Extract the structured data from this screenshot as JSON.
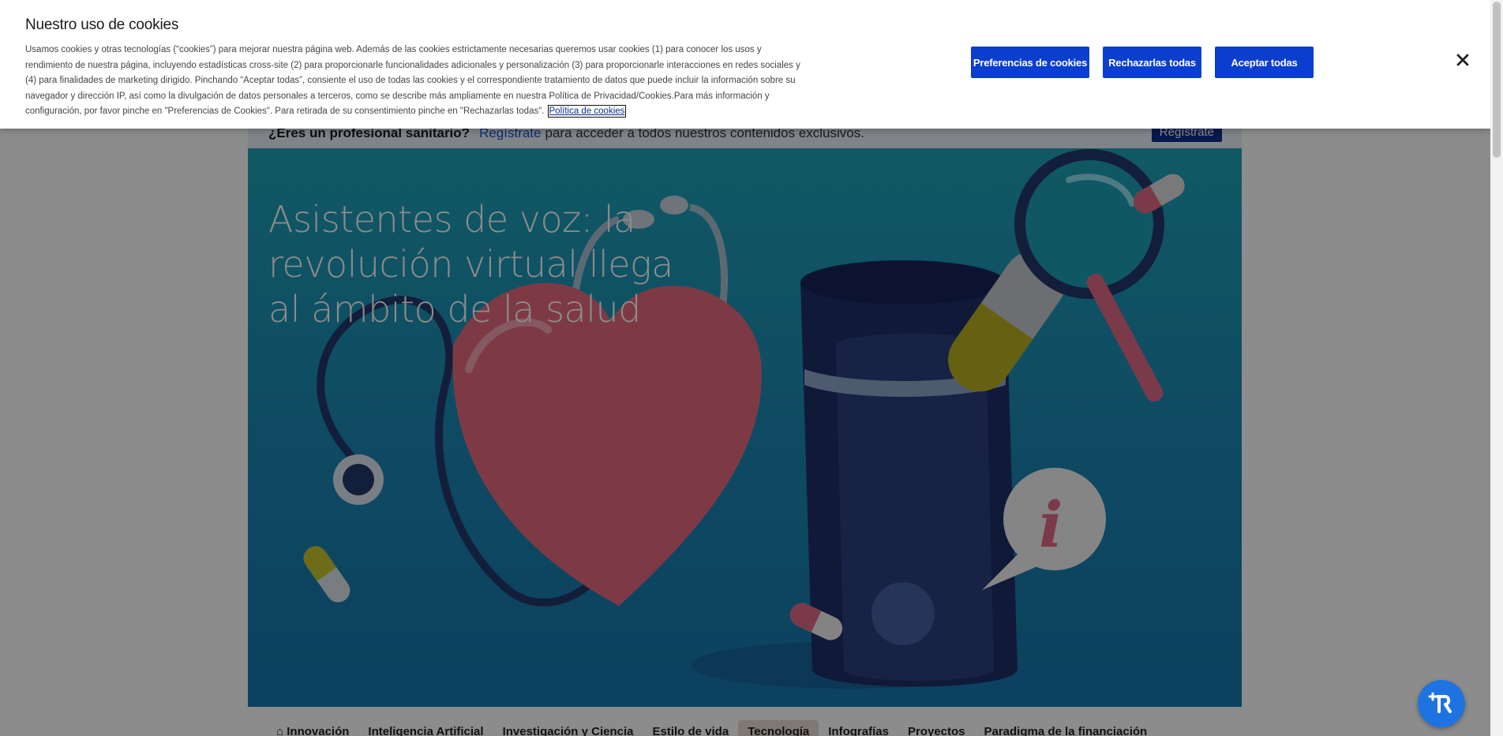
{
  "cookie_banner": {
    "title": "Nuestro uso de cookies",
    "text": "Usamos cookies y otras tecnologías (“cookies”) para mejorar nuestra página web. Además de las cookies estrictamente necesarias queremos usar cookies (1) para conocer los usos y rendimiento de nuestra página, incluyendo estadísticas cross-site (2) para proporcionarle funcionalidades adicionales y personalización (3) para proporcionarle interacciones en redes sociales y (4) para finalidades de marketing dirigido. Pinchando “Aceptar todas”, consiente el uso de todas las cookies y el correspondiente tratamiento de datos que puede incluir la información sobre su navegador y dirección IP, así como la divulgación de datos personales a terceros, como se describe más ampliamente en nuestra Política de Privacidad/Cookies.Para más información y configuración, por favor pinche en \"Preferencias de Cookies\". Para retirada de su consentimiento pinche en \"Rechazarlas todas\".",
    "policy_link": "Política de cookies",
    "buttons": {
      "preferences": "Preferencias de cookies",
      "reject": "Rechazarlas todas",
      "accept": "Aceptar todas"
    },
    "close_icon": "close-icon"
  },
  "pro_bar": {
    "question": "¿Eres un profesional sanitario?",
    "link": "Regístrate",
    "rest": "para acceder a todos nuestros contenidos exclusivos.",
    "button": "Regístrate"
  },
  "hero": {
    "title": "Asistentes de voz: la revolución virtual llega al ámbito de la salud"
  },
  "nav": {
    "items": [
      {
        "label": "Innovación",
        "icon": "home-icon"
      },
      {
        "label": "Inteligencia Artificial"
      },
      {
        "label": "Investigación y Ciencia"
      },
      {
        "label": "Estilo de vida"
      },
      {
        "label": "Tecnología",
        "active": true
      },
      {
        "label": "Infografías"
      },
      {
        "label": "Proyectos"
      },
      {
        "label": "Paradigma de la financiación"
      }
    ]
  },
  "widget": {
    "icon": "accessibility-widget-icon"
  },
  "colors": {
    "button_blue": "#0b3ecf",
    "hero_teal": "#1fa2b8",
    "overlay": "rgba(0,0,0,0.45)"
  }
}
